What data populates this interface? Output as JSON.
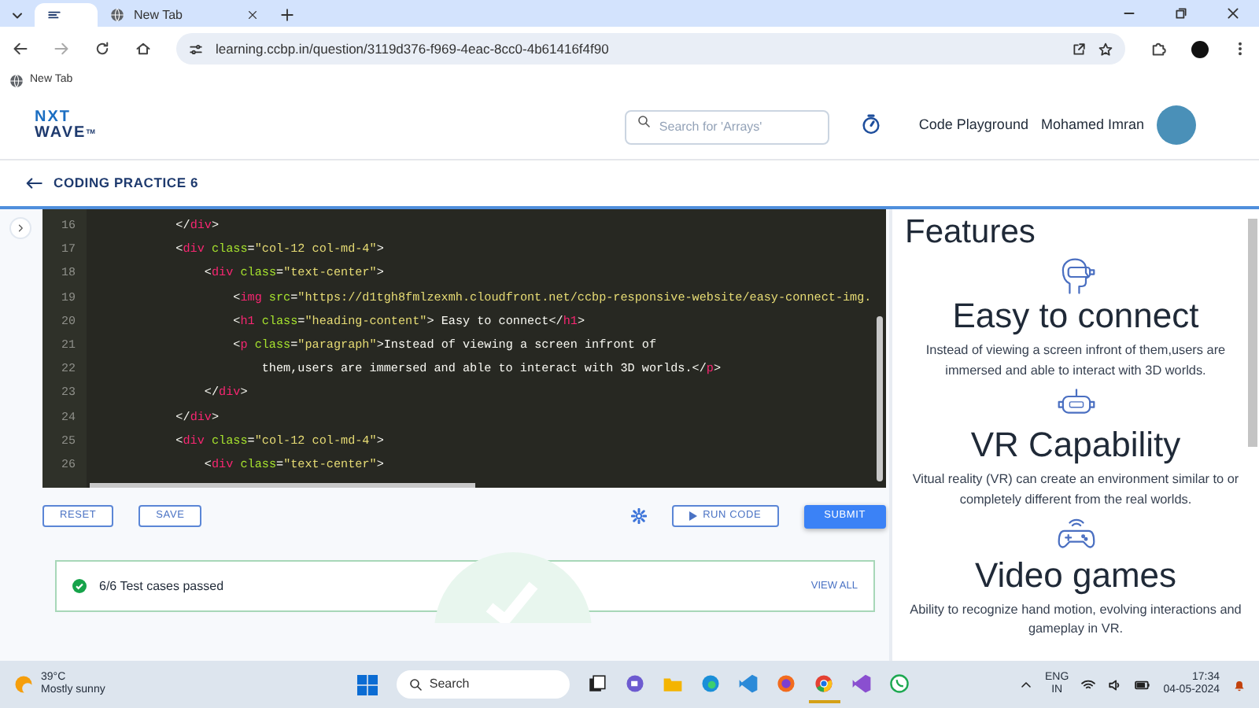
{
  "browser": {
    "tabs": [
      {
        "selected": true
      },
      {
        "title": "New Tab",
        "selected": false
      }
    ],
    "address": "learning.ccbp.in/question/3119d376-f969-4eac-8cc0-4b61416f4f90",
    "bookmarks": [
      "New Tab"
    ]
  },
  "header": {
    "logo_top": "NXT",
    "logo_bottom": "WAVE",
    "logo_mark": "TM",
    "search": {
      "placeholder": "Search for 'Arrays'"
    },
    "link": "Code Playground",
    "user": "Mohamed Imran"
  },
  "page_title": "CODING PRACTICE 6",
  "editor": {
    "lines": [
      {
        "number": "16",
        "tokens": [
          {
            "kind": "punct",
            "text": "            </"
          },
          {
            "kind": "tag",
            "text": "div"
          },
          {
            "kind": "punct",
            "text": ">"
          }
        ]
      },
      {
        "number": "17",
        "tokens": [
          {
            "kind": "punct",
            "text": "            <"
          },
          {
            "kind": "tag",
            "text": "div"
          },
          {
            "kind": "attr",
            "text": " class"
          },
          {
            "kind": "punct",
            "text": "="
          },
          {
            "kind": "string",
            "text": "\"col-12 col-md-4\""
          },
          {
            "kind": "punct",
            "text": ">"
          }
        ]
      },
      {
        "number": "18",
        "tokens": [
          {
            "kind": "punct",
            "text": "                <"
          },
          {
            "kind": "tag",
            "text": "div"
          },
          {
            "kind": "attr",
            "text": " class"
          },
          {
            "kind": "punct",
            "text": "="
          },
          {
            "kind": "string",
            "text": "\"text-center\""
          },
          {
            "kind": "punct",
            "text": ">"
          }
        ]
      },
      {
        "number": "19",
        "tokens": [
          {
            "kind": "punct",
            "text": "                    <"
          },
          {
            "kind": "tag",
            "text": "img"
          },
          {
            "kind": "attr",
            "text": " src"
          },
          {
            "kind": "punct",
            "text": "="
          },
          {
            "kind": "string",
            "text": "\"https://d1tgh8fmlzexmh.cloudfront.net/ccbp-responsive-website/easy-connect-img."
          }
        ]
      },
      {
        "number": "20",
        "tokens": [
          {
            "kind": "punct",
            "text": "                    <"
          },
          {
            "kind": "tag",
            "text": "h1"
          },
          {
            "kind": "attr",
            "text": " class"
          },
          {
            "kind": "punct",
            "text": "="
          },
          {
            "kind": "string",
            "text": "\"heading-content\""
          },
          {
            "kind": "punct",
            "text": ">"
          },
          {
            "kind": "text",
            "text": " Easy to connect</"
          },
          {
            "kind": "tag",
            "text": "h1"
          },
          {
            "kind": "punct",
            "text": ">"
          }
        ]
      },
      {
        "number": "21",
        "tokens": [
          {
            "kind": "punct",
            "text": "                    <"
          },
          {
            "kind": "tag",
            "text": "p"
          },
          {
            "kind": "attr",
            "text": " class"
          },
          {
            "kind": "punct",
            "text": "="
          },
          {
            "kind": "string",
            "text": "\"paragraph\""
          },
          {
            "kind": "punct",
            "text": ">"
          },
          {
            "kind": "text",
            "text": "Instead of viewing a screen infront of"
          }
        ]
      },
      {
        "number": "22",
        "tokens": [
          {
            "kind": "text",
            "text": "                        them,users are immersed and able to interact with 3D worlds.</"
          },
          {
            "kind": "tag",
            "text": "p"
          },
          {
            "kind": "punct",
            "text": ">"
          }
        ]
      },
      {
        "number": "23",
        "tokens": [
          {
            "kind": "punct",
            "text": "                </"
          },
          {
            "kind": "tag",
            "text": "div"
          },
          {
            "kind": "punct",
            "text": ">"
          }
        ]
      },
      {
        "number": "24",
        "tokens": [
          {
            "kind": "punct",
            "text": "            </"
          },
          {
            "kind": "tag",
            "text": "div"
          },
          {
            "kind": "punct",
            "text": ">"
          }
        ]
      },
      {
        "number": "25",
        "tokens": [
          {
            "kind": "punct",
            "text": "            <"
          },
          {
            "kind": "tag",
            "text": "div"
          },
          {
            "kind": "attr",
            "text": " class"
          },
          {
            "kind": "punct",
            "text": "="
          },
          {
            "kind": "string",
            "text": "\"col-12 col-md-4\""
          },
          {
            "kind": "punct",
            "text": ">"
          }
        ]
      },
      {
        "number": "26",
        "tokens": [
          {
            "kind": "punct",
            "text": "                <"
          },
          {
            "kind": "tag",
            "text": "div"
          },
          {
            "kind": "attr",
            "text": " class"
          },
          {
            "kind": "punct",
            "text": "="
          },
          {
            "kind": "string",
            "text": "\"text-center\""
          },
          {
            "kind": "punct",
            "text": ">"
          }
        ]
      }
    ]
  },
  "actions": [
    {
      "label": "RESET",
      "kind": "outline"
    },
    {
      "label": "SAVE",
      "kind": "outline"
    },
    {
      "kind": "settings"
    },
    {
      "label": "RUN CODE",
      "kind": "run"
    },
    {
      "label": "SUBMIT",
      "kind": "primary"
    }
  ],
  "result": {
    "passed": true,
    "text": "6/6 Test cases passed",
    "link": "VIEW ALL"
  },
  "preview": {
    "heading": "Features",
    "features": [
      {
        "kind": "headset",
        "title": "Easy to connect",
        "text": "Instead of viewing a screen infront of them,users are immersed and able to interact with 3D worlds."
      },
      {
        "kind": "goggles",
        "title": "VR Capability",
        "text": "Vitual reality (VR) can create an environment similar to or completely different from the real worlds."
      },
      {
        "kind": "gamepad",
        "title": "Video games",
        "text": "Ability to recognize hand motion, evolving interactions and gameplay in VR."
      }
    ]
  },
  "taskbar": {
    "temperature": "39°C",
    "weather": "Mostly sunny",
    "search": "Search",
    "apps": [
      {
        "kind": "taskview",
        "selected": false
      },
      {
        "kind": "chat",
        "selected": false
      },
      {
        "kind": "folder",
        "selected": false
      },
      {
        "kind": "edge",
        "selected": false
      },
      {
        "kind": "code",
        "selected": false
      },
      {
        "kind": "firefox",
        "selected": false
      },
      {
        "kind": "chrome",
        "selected": true
      },
      {
        "kind": "studio",
        "selected": false
      },
      {
        "kind": "whatsapp",
        "selected": false
      }
    ],
    "language": "ENG",
    "region": "IN",
    "time": "17:34",
    "date": "04-05-2024"
  }
}
